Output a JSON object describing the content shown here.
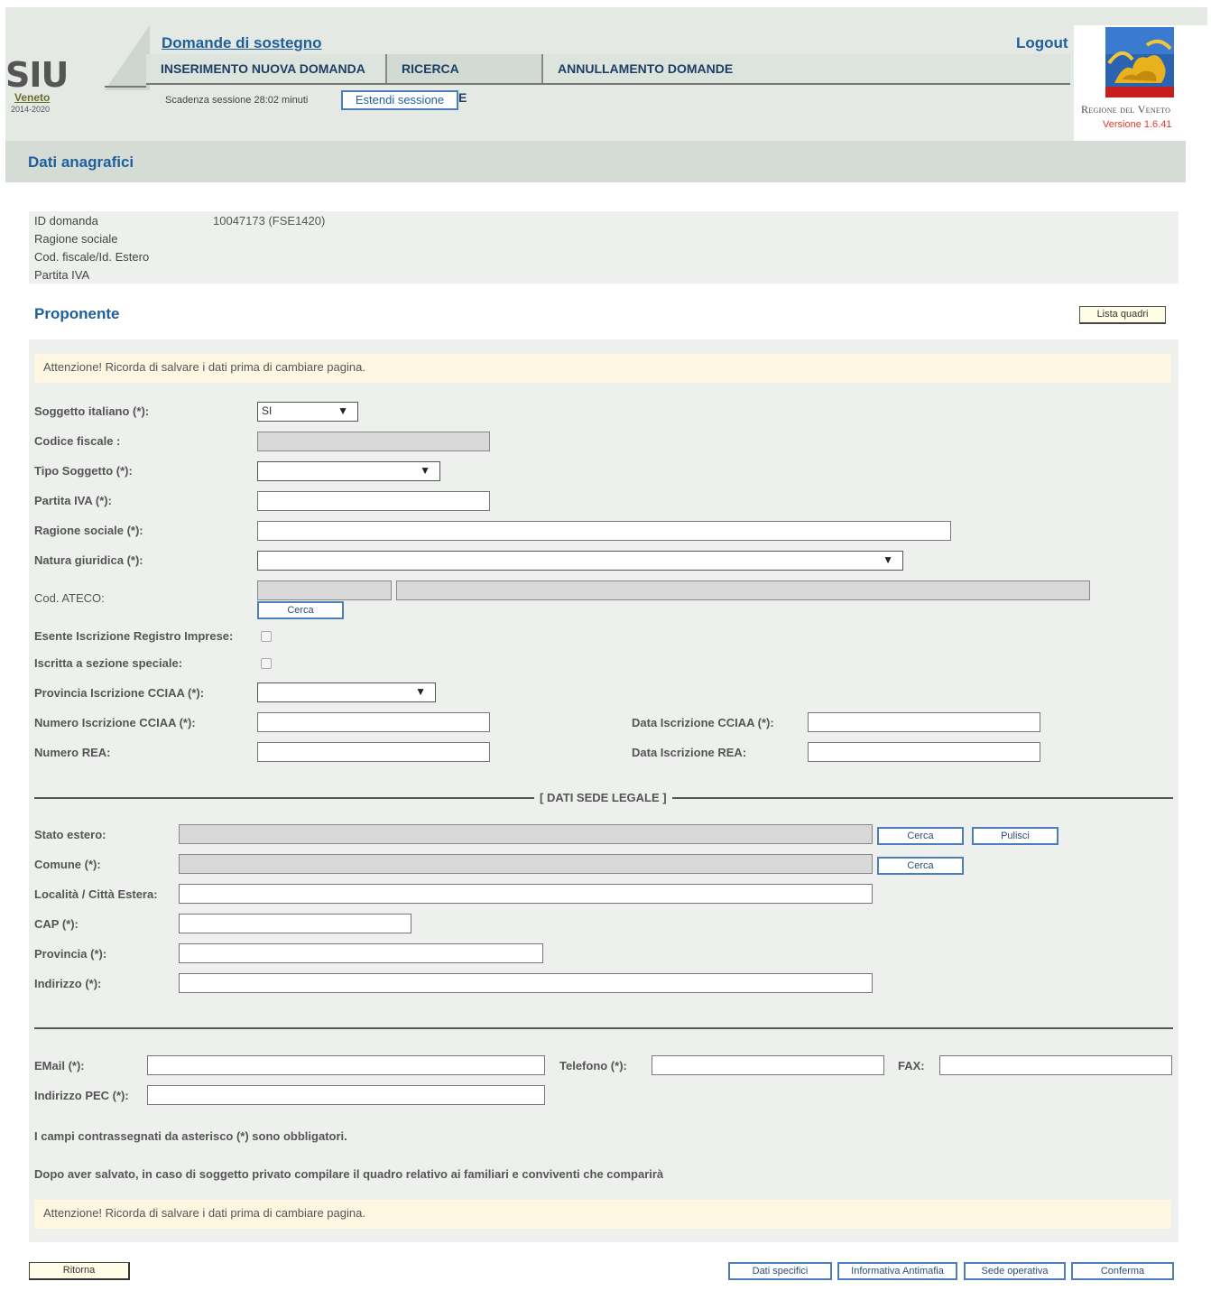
{
  "header": {
    "app_short": "SIU",
    "app_region": "Veneto",
    "app_years": "2014-2020",
    "title": "Domande di sostegno",
    "logout": "Logout",
    "menu": [
      {
        "label": "INSERIMENTO NUOVA DOMANDA"
      },
      {
        "label": "RICERCA DOMANDE"
      },
      {
        "label": "ANNULLAMENTO DOMANDE"
      }
    ],
    "session_text": "Scadenza sessione 28:02 minuti",
    "extend_session": "Estendi sessione",
    "region_name": "Regione del Veneto",
    "version": "Versione 1.6.41"
  },
  "section_title": "Dati anagrafici",
  "info": {
    "rows": [
      {
        "label": "ID domanda",
        "value": "10047173 (FSE1420)"
      },
      {
        "label": "Ragione sociale",
        "value": ""
      },
      {
        "label": "Cod. fiscale/Id. Estero",
        "value": ""
      },
      {
        "label": "Partita IVA",
        "value": ""
      }
    ]
  },
  "proponente": {
    "title": "Proponente",
    "lista_quadri": "Lista quadri"
  },
  "form": {
    "warning": "Attenzione! Ricorda di salvare i dati prima di cambiare pagina.",
    "soggetto_italiano": {
      "label": "Soggetto italiano (*):",
      "value": "SI"
    },
    "codice_fiscale": {
      "label": "Codice fiscale :",
      "value": ""
    },
    "tipo_soggetto": {
      "label": "Tipo Soggetto (*):",
      "value": ""
    },
    "partita_iva": {
      "label": "Partita IVA (*):",
      "value": ""
    },
    "ragione_sociale": {
      "label": "Ragione sociale (*):",
      "value": ""
    },
    "natura_giuridica": {
      "label": "Natura giuridica (*):",
      "value": ""
    },
    "cod_ateco": {
      "label": "Cod. ATECO:",
      "code": "",
      "desc": "",
      "cerca": "Cerca"
    },
    "esente": {
      "label": "Esente Iscrizione Registro Imprese:",
      "checked": false
    },
    "iscritta": {
      "label": "Iscritta a sezione speciale:",
      "checked": false
    },
    "provincia_cciaa": {
      "label": "Provincia Iscrizione CCIAA (*):",
      "value": ""
    },
    "numero_cciaa": {
      "label": "Numero Iscrizione CCIAA (*):",
      "value": ""
    },
    "data_cciaa": {
      "label": "Data Iscrizione CCIAA (*):",
      "value": ""
    },
    "numero_rea": {
      "label": "Numero REA:",
      "value": ""
    },
    "data_rea": {
      "label": "Data Iscrizione REA:",
      "value": ""
    },
    "sede_legale_title": "[ DATI SEDE LEGALE ]",
    "stato_estero": {
      "label": "Stato estero:",
      "value": "",
      "cerca": "Cerca",
      "pulisci": "Pulisci"
    },
    "comune": {
      "label": "Comune (*):",
      "value": "",
      "cerca": "Cerca"
    },
    "localita": {
      "label": "Località / Città Estera:",
      "value": ""
    },
    "cap": {
      "label": "CAP (*):",
      "value": ""
    },
    "provincia": {
      "label": "Provincia (*):",
      "value": ""
    },
    "indirizzo": {
      "label": "Indirizzo (*):",
      "value": ""
    },
    "email": {
      "label": "EMail (*):",
      "value": ""
    },
    "telefono": {
      "label": "Telefono (*):",
      "value": ""
    },
    "fax": {
      "label": "FAX:",
      "value": ""
    },
    "pec": {
      "label": "Indirizzo PEC (*):",
      "value": ""
    },
    "note1": "I campi contrassegnati da asterisco (*) sono obbligatori.",
    "note2": "Dopo aver salvato, in caso di soggetto privato compilare il quadro relativo ai familiari e conviventi che comparirà"
  },
  "footer": {
    "ritorna": "Ritorna",
    "dati_specifici": "Dati specifici",
    "informativa": "Informativa Antimafia",
    "sede_operativa": "Sede operativa",
    "conferma": "Conferma"
  }
}
